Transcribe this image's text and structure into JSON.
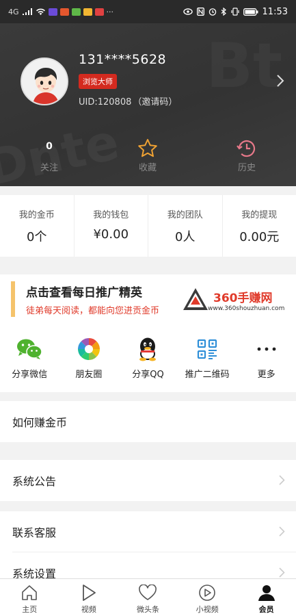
{
  "status_bar": {
    "network": "4G",
    "time": "11:53",
    "more": "···"
  },
  "profile": {
    "phone": "131****5628",
    "level_badge": "浏览大师",
    "uid_label": "UID:120808",
    "invite_label": "（邀请码）",
    "stats": [
      {
        "value": "0",
        "label": "关注"
      },
      {
        "icon": "star-outline-icon",
        "label": "收藏"
      },
      {
        "icon": "clock-history-icon",
        "label": "历史"
      }
    ]
  },
  "wallet": [
    {
      "label": "我的金币",
      "value": "0个"
    },
    {
      "label": "我的钱包",
      "value": "¥0.00"
    },
    {
      "label": "我的团队",
      "value": "0人"
    },
    {
      "label": "我的提现",
      "value": "0.00元"
    }
  ],
  "promo": {
    "title": "点击查看每日推广精英",
    "subtitle": "徒弟每天阅读，都能向您进贡金币",
    "logo_text": "360手赚网",
    "logo_url": "www.360shouzhuan.com"
  },
  "share": [
    {
      "label": "分享微信",
      "icon": "wechat-icon"
    },
    {
      "label": "朋友圈",
      "icon": "moments-icon"
    },
    {
      "label": "分享QQ",
      "icon": "qq-icon"
    },
    {
      "label": "推广二维码",
      "icon": "qrcode-icon"
    },
    {
      "label": "更多",
      "icon": "more-icon"
    }
  ],
  "menu": [
    {
      "label": "如何赚金币"
    },
    {
      "label": "系统公告"
    },
    {
      "label": "联系客服"
    },
    {
      "label": "系统设置"
    }
  ],
  "tabs": [
    {
      "label": "主页",
      "icon": "home-icon"
    },
    {
      "label": "视频",
      "icon": "play-icon"
    },
    {
      "label": "微头条",
      "icon": "heart-icon"
    },
    {
      "label": "小视频",
      "icon": "small-video-icon"
    },
    {
      "label": "会员",
      "icon": "member-icon",
      "active": true
    }
  ],
  "colors": {
    "header_bg": "#383838",
    "accent_red": "#e03a2a",
    "badge_red": "#d42a1f",
    "star_orange": "#f0a233",
    "history_pink": "#e8798a",
    "promo_bar": "#f5c36b"
  }
}
